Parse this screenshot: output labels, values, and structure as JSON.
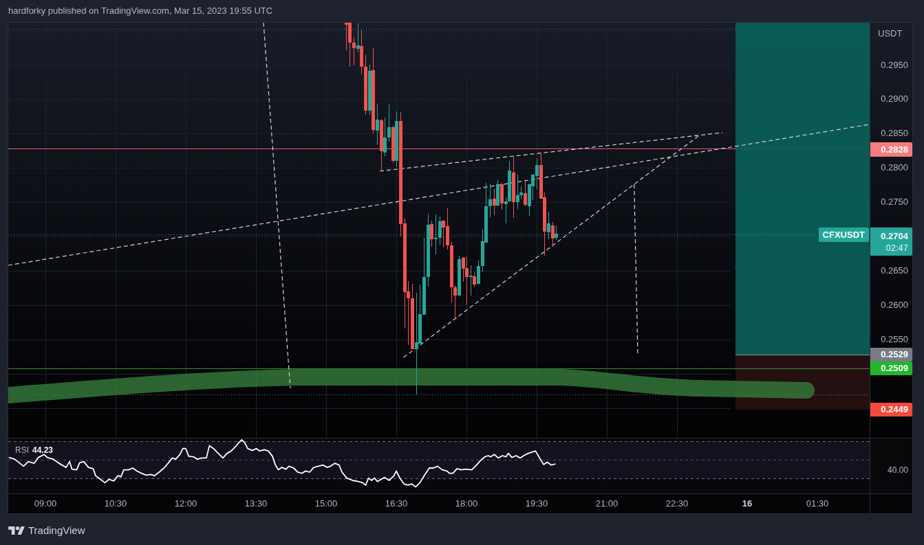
{
  "header": {
    "text": "hardforky published on TradingView.com, Mar 15, 2023 19:55 UTC"
  },
  "chart": {
    "symbol_label": "CFXUSDT",
    "currency": "USDT",
    "price_ticks": [
      "0.2950",
      "0.2900",
      "0.2850",
      "0.2800",
      "0.2750",
      "0.2650",
      "0.2600",
      "0.2550"
    ],
    "price_badges": [
      {
        "text": "0.2828",
        "color": "#f77c80"
      },
      {
        "text": "0.2529",
        "color": "#787b86"
      },
      {
        "text": "0.2509",
        "color": "#22b52b"
      },
      {
        "text": "0.2449",
        "color": "#f24a3d"
      }
    ],
    "last_price": {
      "price": "0.2704",
      "countdown": "02:47"
    }
  },
  "rsi": {
    "name": "RSI",
    "value": "44.23",
    "axis_label": "40.00"
  },
  "time_axis": [
    {
      "kind": "time",
      "label": "09:00"
    },
    {
      "kind": "time",
      "label": "10:30"
    },
    {
      "kind": "time",
      "label": "12:00"
    },
    {
      "kind": "time",
      "label": "13:30"
    },
    {
      "kind": "time",
      "label": "15:00"
    },
    {
      "kind": "time",
      "label": "16:30"
    },
    {
      "kind": "time",
      "label": "18:00"
    },
    {
      "kind": "time",
      "label": "19:30"
    },
    {
      "kind": "time",
      "label": "21:00"
    },
    {
      "kind": "time",
      "label": "22:30"
    },
    {
      "kind": "day",
      "label": "16"
    },
    {
      "kind": "time",
      "label": "01:30"
    }
  ],
  "footer": {
    "brand": "TradingView"
  }
}
